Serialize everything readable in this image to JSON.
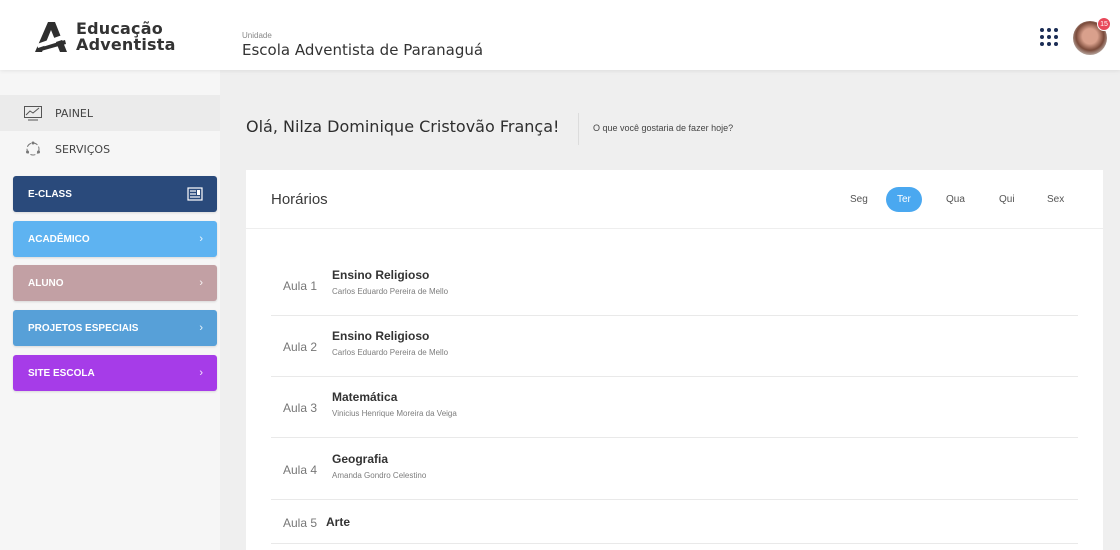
{
  "header": {
    "logo_line1": "Educação",
    "logo_line2": "Adventista",
    "unit_caption": "Unidade",
    "unit_name": "Escola Adventista de Paranaguá",
    "apps_icon": "grid-icon",
    "notification_count": "15"
  },
  "sidebar": {
    "nav": [
      {
        "label": "PAINEL",
        "icon": "chart-line-icon"
      },
      {
        "label": "SERVIÇOS",
        "icon": "services-icon"
      }
    ],
    "menus": [
      {
        "label": "E-CLASS",
        "color": "#2a4a7b",
        "icon": "eclass-icon"
      },
      {
        "label": "ACADÊMICO",
        "color": "#5eb3f1",
        "chevron": "›"
      },
      {
        "label": "ALUNO",
        "color": "#c2a0a4",
        "chevron": "›"
      },
      {
        "label": "PROJETOS ESPECIAIS",
        "color": "#57a0d8",
        "chevron": "›"
      },
      {
        "label": "SITE ESCOLA",
        "color": "#a63ce8",
        "chevron": "›"
      }
    ]
  },
  "main": {
    "greeting": "Olá, Nilza Dominique Cristovão França!",
    "question": "O que você gostaria de fazer hoje?",
    "schedule": {
      "title": "Horários",
      "days": [
        "Seg",
        "Ter",
        "Qua",
        "Qui",
        "Sex"
      ],
      "selected_day": "Ter",
      "accent_color": "#4aa8f0",
      "lessons": [
        {
          "num": "Aula 1",
          "subject": "Ensino Religioso",
          "teacher": "Carlos Eduardo Pereira de Mello"
        },
        {
          "num": "Aula 2",
          "subject": "Ensino Religioso",
          "teacher": "Carlos Eduardo Pereira de Mello"
        },
        {
          "num": "Aula 3",
          "subject": "Matemática",
          "teacher": "Vinicius Henrique Moreira da Veiga"
        },
        {
          "num": "Aula 4",
          "subject": "Geografia",
          "teacher": "Amanda Gondro Celestino"
        },
        {
          "num": "Aula 5",
          "subject": "Arte",
          "teacher": ""
        }
      ]
    }
  }
}
